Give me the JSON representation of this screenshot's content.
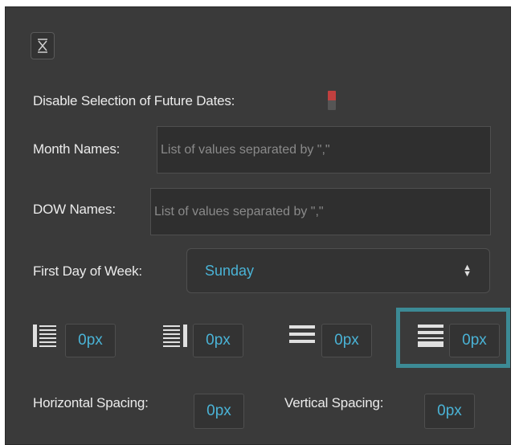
{
  "toolbar": {
    "close_icon": "close-x-icon"
  },
  "disable_future": {
    "label": "Disable Selection of Future Dates:",
    "state": "off",
    "accent_color": "#c0403f"
  },
  "month_names": {
    "label": "Month Names:",
    "value": "",
    "placeholder": "List of values separated by \",\""
  },
  "dow_names": {
    "label": "DOW Names:",
    "value": "",
    "placeholder": "List of values separated by \",\""
  },
  "first_day": {
    "label": "First Day of Week:",
    "selected": "Sunday"
  },
  "alignment": {
    "items": [
      {
        "icon": "align-left-icon",
        "value": "0px"
      },
      {
        "icon": "align-right-icon",
        "value": "0px"
      },
      {
        "icon": "align-center-icon",
        "value": "0px"
      },
      {
        "icon": "align-justify-icon",
        "value": "0px",
        "selected": true
      }
    ]
  },
  "spacing": {
    "horizontal_label": "Horizontal Spacing:",
    "horizontal_value": "0px",
    "vertical_label": "Vertical Spacing:",
    "vertical_value": "0px"
  },
  "colors": {
    "panel_bg": "#3a3a3a",
    "accent": "#4ab3d6",
    "highlight": "#3c8a95"
  }
}
